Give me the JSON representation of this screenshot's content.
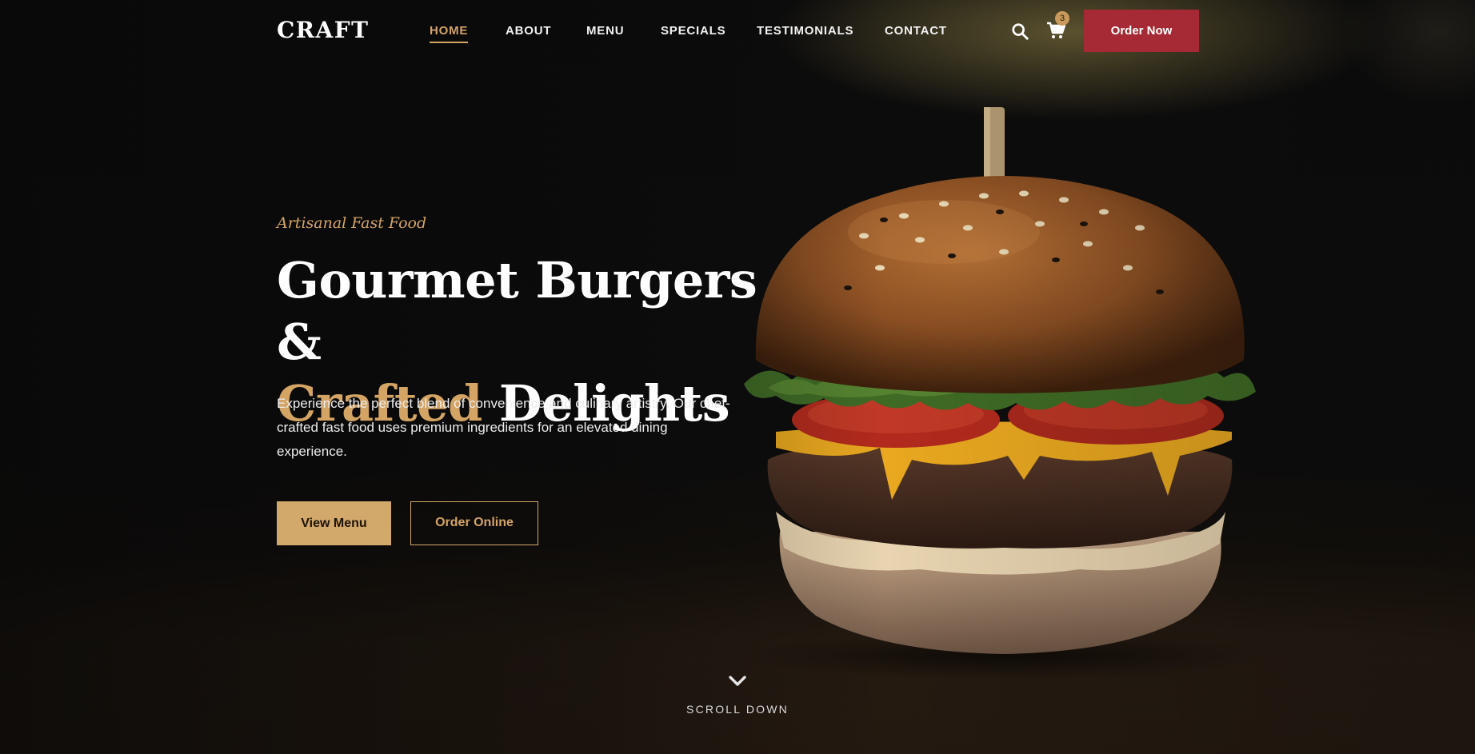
{
  "brand": {
    "logo": "CRAFT"
  },
  "nav": {
    "items": [
      {
        "label": "HOME",
        "active": true
      },
      {
        "label": "ABOUT",
        "active": false
      },
      {
        "label": "MENU",
        "active": false
      },
      {
        "label": "SPECIALS",
        "active": false
      },
      {
        "label": "TESTIMONIALS",
        "active": false
      },
      {
        "label": "CONTACT",
        "active": false
      }
    ],
    "search_icon": "search-icon",
    "cart_icon": "cart-icon",
    "cart_count": "3",
    "order_button": "Order Now"
  },
  "hero": {
    "eyebrow": "Artisanal Fast Food",
    "headline_line1": "Gourmet Burgers &",
    "headline_accent": "Crafted",
    "headline_rest": " Delights",
    "description": "Experience the perfect blend of convenience and culinary artistry. Our chef-crafted fast food uses premium ingredients for an elevated dining experience.",
    "primary_button": "View Menu",
    "secondary_button": "Order Online",
    "image": "gourmet-burger-photo"
  },
  "scroll": {
    "icon": "chevron-down-icon",
    "label": "SCROLL DOWN"
  },
  "colors": {
    "accent_gold": "#d4a464",
    "button_gold": "#d2a86b",
    "order_red": "#a52a35",
    "background": "#0b0b0b",
    "text": "#ffffff"
  }
}
